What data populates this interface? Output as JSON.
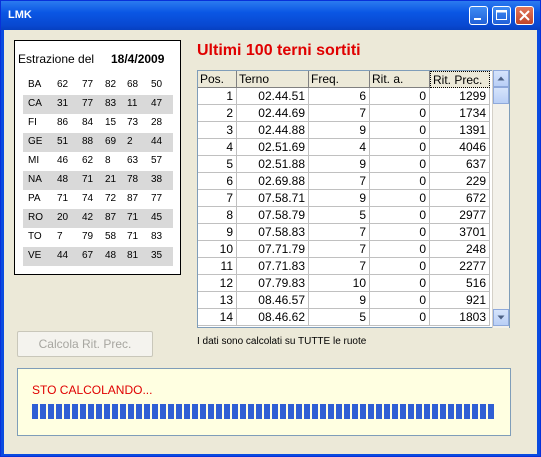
{
  "window": {
    "title": "LMK"
  },
  "estrazione": {
    "label": "Estrazione del",
    "date": "18/4/2009",
    "wheels": [
      {
        "name": "BA",
        "numbers": [
          "62",
          "77",
          "82",
          "68",
          "50"
        ]
      },
      {
        "name": "CA",
        "numbers": [
          "31",
          "77",
          "83",
          "11",
          "47"
        ]
      },
      {
        "name": "FI",
        "numbers": [
          "86",
          "84",
          "15",
          "73",
          "28"
        ]
      },
      {
        "name": "GE",
        "numbers": [
          "51",
          "88",
          "69",
          "2",
          "44"
        ]
      },
      {
        "name": "MI",
        "numbers": [
          "46",
          "62",
          "8",
          "63",
          "57"
        ]
      },
      {
        "name": "NA",
        "numbers": [
          "48",
          "71",
          "21",
          "78",
          "38"
        ]
      },
      {
        "name": "PA",
        "numbers": [
          "71",
          "74",
          "72",
          "87",
          "77"
        ]
      },
      {
        "name": "RO",
        "numbers": [
          "20",
          "42",
          "87",
          "71",
          "45"
        ]
      },
      {
        "name": "TO",
        "numbers": [
          "7",
          "79",
          "58",
          "71",
          "83"
        ]
      },
      {
        "name": "VE",
        "numbers": [
          "44",
          "67",
          "48",
          "81",
          "35"
        ]
      }
    ]
  },
  "heading": "Ultimi 100 terni sortiti",
  "grid": {
    "columns": [
      "Pos.",
      "Terno",
      "Freq.",
      "Rit. a.",
      "Rit. Prec."
    ],
    "rows": [
      [
        "1",
        "02.44.51",
        "6",
        "0",
        "1299"
      ],
      [
        "2",
        "02.44.69",
        "7",
        "0",
        "1734"
      ],
      [
        "3",
        "02.44.88",
        "9",
        "0",
        "1391"
      ],
      [
        "4",
        "02.51.69",
        "4",
        "0",
        "4046"
      ],
      [
        "5",
        "02.51.88",
        "9",
        "0",
        "637"
      ],
      [
        "6",
        "02.69.88",
        "7",
        "0",
        "229"
      ],
      [
        "7",
        "07.58.71",
        "9",
        "0",
        "672"
      ],
      [
        "8",
        "07.58.79",
        "5",
        "0",
        "2977"
      ],
      [
        "9",
        "07.58.83",
        "7",
        "0",
        "3701"
      ],
      [
        "10",
        "07.71.79",
        "7",
        "0",
        "248"
      ],
      [
        "11",
        "07.71.83",
        "7",
        "0",
        "2277"
      ],
      [
        "12",
        "07.79.83",
        "10",
        "0",
        "516"
      ],
      [
        "13",
        "08.46.57",
        "9",
        "0",
        "921"
      ],
      [
        "14",
        "08.46.62",
        "5",
        "0",
        "1803"
      ]
    ]
  },
  "calc_button": {
    "label": "Calcola Rit. Prec.",
    "enabled": false
  },
  "note": "I dati sono calcolati su TUTTE le ruote",
  "status": {
    "text": "STO CALCOLANDO...",
    "progress": 1.0
  },
  "colors": {
    "heading": "#e00000",
    "status_text": "#e00000",
    "progress": "#2f5fd4",
    "status_bg": "#ffffe1"
  }
}
